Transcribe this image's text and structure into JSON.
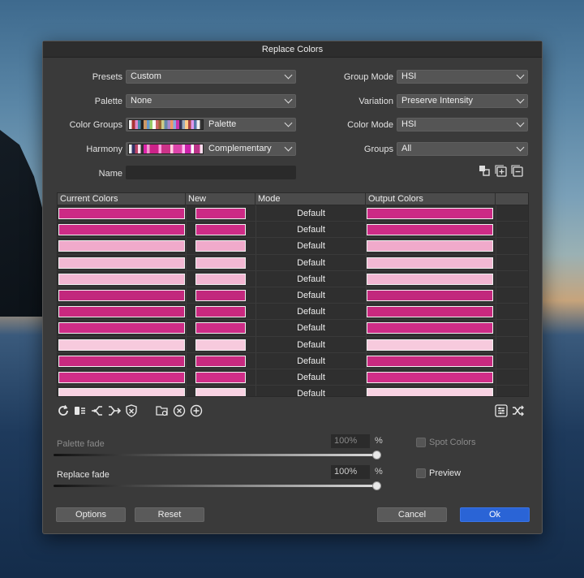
{
  "dialog": {
    "title": "Replace Colors"
  },
  "left_fields": [
    {
      "label": "Presets",
      "value": "Custom"
    },
    {
      "label": "Palette",
      "value": "None"
    },
    {
      "label": "Color Groups",
      "value": "Palette"
    },
    {
      "label": "Harmony",
      "value": "Complementary"
    },
    {
      "label": "Name",
      "value": ""
    }
  ],
  "right_fields": [
    {
      "label": "Group Mode",
      "value": "HSI"
    },
    {
      "label": "Variation",
      "value": "Preserve Intensity"
    },
    {
      "label": "Color Mode",
      "value": "HSI"
    },
    {
      "label": "Groups",
      "value": "All"
    }
  ],
  "table": {
    "headers": [
      "Current Colors",
      "New",
      "Mode",
      "Output Colors"
    ],
    "rows": [
      {
        "current": "#cc2a85",
        "new": "#cc2a85",
        "mode": "Default",
        "output": "#cc2a85"
      },
      {
        "current": "#cf2c87",
        "new": "#cf2c87",
        "mode": "Default",
        "output": "#cf2c87"
      },
      {
        "current": "#f0aacb",
        "new": "#f0aacb",
        "mode": "Default",
        "output": "#f0aacb"
      },
      {
        "current": "#f2b8d3",
        "new": "#f2b8d3",
        "mode": "Default",
        "output": "#f2b8d3"
      },
      {
        "current": "#f3b6d2",
        "new": "#f3b6d2",
        "mode": "Default",
        "output": "#f3b6d2"
      },
      {
        "current": "#c2287d",
        "new": "#c2287d",
        "mode": "Default",
        "output": "#c2287d"
      },
      {
        "current": "#c9287f",
        "new": "#c9287f",
        "mode": "Default",
        "output": "#c9287f"
      },
      {
        "current": "#cd2c86",
        "new": "#cd2c86",
        "mode": "Default",
        "output": "#cd2c86"
      },
      {
        "current": "#f7cadd",
        "new": "#f7cadd",
        "mode": "Default",
        "output": "#f7cadd"
      },
      {
        "current": "#c82a80",
        "new": "#c82a80",
        "mode": "Default",
        "output": "#c82a80"
      },
      {
        "current": "#d02d88",
        "new": "#d02d88",
        "mode": "Default",
        "output": "#d02d88"
      },
      {
        "current": "#f8d2e2",
        "new": "#f8d2e2",
        "mode": "Default",
        "output": "#f8d2e2"
      }
    ]
  },
  "sliders": {
    "palette_fade": {
      "label": "Palette fade",
      "value": "100%",
      "unit": "%"
    },
    "replace_fade": {
      "label": "Replace fade",
      "value": "100%",
      "unit": "%"
    }
  },
  "checkboxes": {
    "spot_colors": {
      "label": "Spot Colors",
      "checked": false
    },
    "preview": {
      "label": "Preview",
      "checked": false
    }
  },
  "buttons": {
    "options": "Options",
    "reset": "Reset",
    "cancel": "Cancel",
    "ok": "Ok"
  },
  "colors": {
    "accent": "#2a64d6",
    "dialog_bg": "#3a3a3a"
  }
}
